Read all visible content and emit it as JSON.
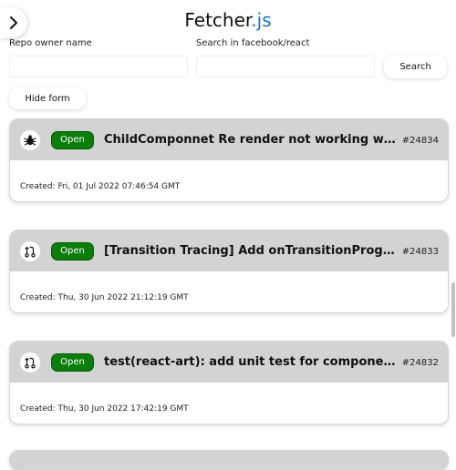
{
  "header": {
    "title_main": "Fetcher",
    "title_accent": ".js",
    "menu_icon": "chevron-right-icon"
  },
  "form": {
    "owner_label": "Repo owner name",
    "owner_value": "",
    "search_label": "Search in facebook/react",
    "search_value": "",
    "search_button": "Search",
    "hide_button": "Hide form"
  },
  "issues": [
    {
      "icon": "bug-icon",
      "status": "Open",
      "title": "ChildComponnet Re render not working with K...",
      "number": "#24834",
      "created": "Created: Fri, 01 Jul 2022 07:46:54 GMT"
    },
    {
      "icon": "pull-request-icon",
      "status": "Open",
      "title": "[Transition Tracing] Add onTransitionProgress ...",
      "number": "#24833",
      "created": "Created: Thu, 30 Jun 2022 21:12:19 GMT"
    },
    {
      "icon": "pull-request-icon",
      "status": "Open",
      "title": "test(react-art): add unit test for component res...",
      "number": "#24832",
      "created": "Created: Thu, 30 Jun 2022 17:42:19 GMT"
    }
  ],
  "colors": {
    "accent": "#1a73c7",
    "open_badge": "#0b7d0b",
    "card_header": "#d3d3d3"
  }
}
